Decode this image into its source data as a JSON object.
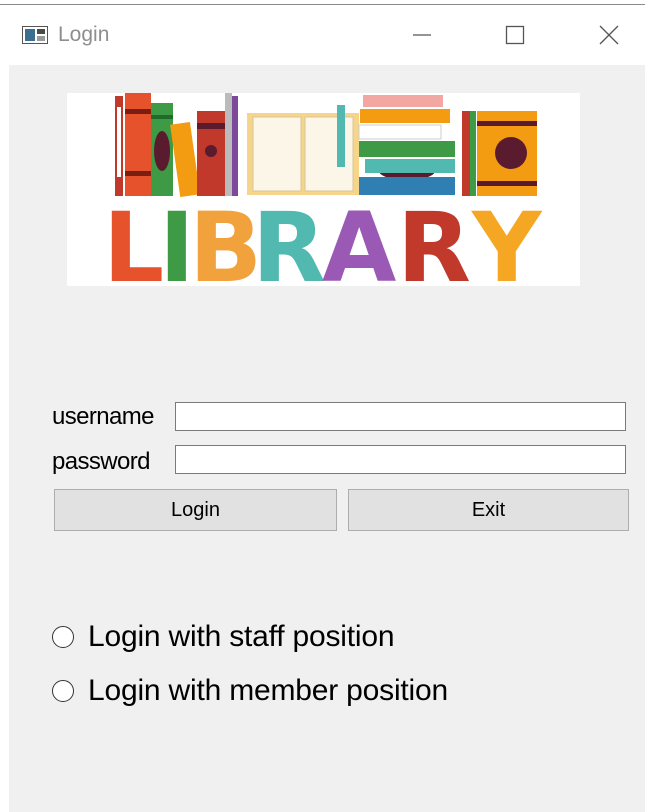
{
  "window": {
    "title": "Login",
    "icons": [
      "app-window-icon",
      "minimize-icon",
      "maximize-icon",
      "close-icon"
    ]
  },
  "banner": {
    "text": "LIBRARY",
    "letter_colors": [
      "#e5522b",
      "#f2a23c",
      "#f2a23c",
      "#52b9b0",
      "#9b59b6",
      "#c0392b",
      "#f5a623"
    ]
  },
  "form": {
    "username_label": "username",
    "username_value": "",
    "password_label": "password",
    "password_value": "",
    "login_label": "Login",
    "exit_label": "Exit"
  },
  "roles": {
    "staff_label": "Login with staff position",
    "member_label": "Login with member position",
    "selected": null
  },
  "colors": {
    "client_bg": "#f0f0f0",
    "button_bg": "#e1e1e1",
    "button_border": "#adadad",
    "title_text": "#8e8e8e"
  }
}
